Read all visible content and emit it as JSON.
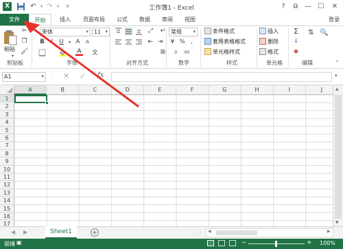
{
  "title": "工作簿1 - Excel",
  "colors": {
    "accent": "#217346",
    "arrow": "#e8322a"
  },
  "window": {
    "help": "?",
    "restore": "⧉",
    "minimize": "—",
    "maximize": "☐",
    "close": "✕"
  },
  "tabs": [
    "文件",
    "开始",
    "插入",
    "页面布局",
    "公式",
    "数据",
    "审阅",
    "视图"
  ],
  "account": "登录",
  "ribbon": {
    "clipboard": {
      "paste": "粘贴",
      "group": "剪贴板"
    },
    "font": {
      "name": "宋体",
      "size": "11",
      "group": "字体",
      "grow": "A",
      "shrink": "A",
      "bold": "B",
      "italic": "I",
      "underline": "U",
      "fontcolor": "A",
      "pinyin": "文"
    },
    "alignment": {
      "group": "对齐方式"
    },
    "number": {
      "format": "常规",
      "group": "数字",
      "percent": "%",
      "comma": ","
    },
    "styles": {
      "conditional": "条件格式",
      "table": "套用表格格式",
      "cell": "单元格样式",
      "group": "样式"
    },
    "cells": {
      "insert": "插入",
      "delete": "删除",
      "format": "格式",
      "group": "单元格"
    },
    "editing": {
      "sum": "Σ",
      "fill": "↓",
      "clear": "◆",
      "group": "编辑"
    }
  },
  "formula_bar": {
    "name_box": "A1",
    "fx": "fx",
    "value": ""
  },
  "columns": [
    "A",
    "B",
    "C",
    "D",
    "E",
    "F",
    "G",
    "H",
    "I",
    "J"
  ],
  "rows": [
    "1",
    "2",
    "3",
    "4",
    "5",
    "6",
    "7",
    "8",
    "9",
    "10",
    "11",
    "12",
    "13",
    "14",
    "15",
    "16",
    "17"
  ],
  "sheets": {
    "active": "Sheet1",
    "add": "+"
  },
  "status": {
    "ready": "就绪",
    "zoom": "100%"
  }
}
